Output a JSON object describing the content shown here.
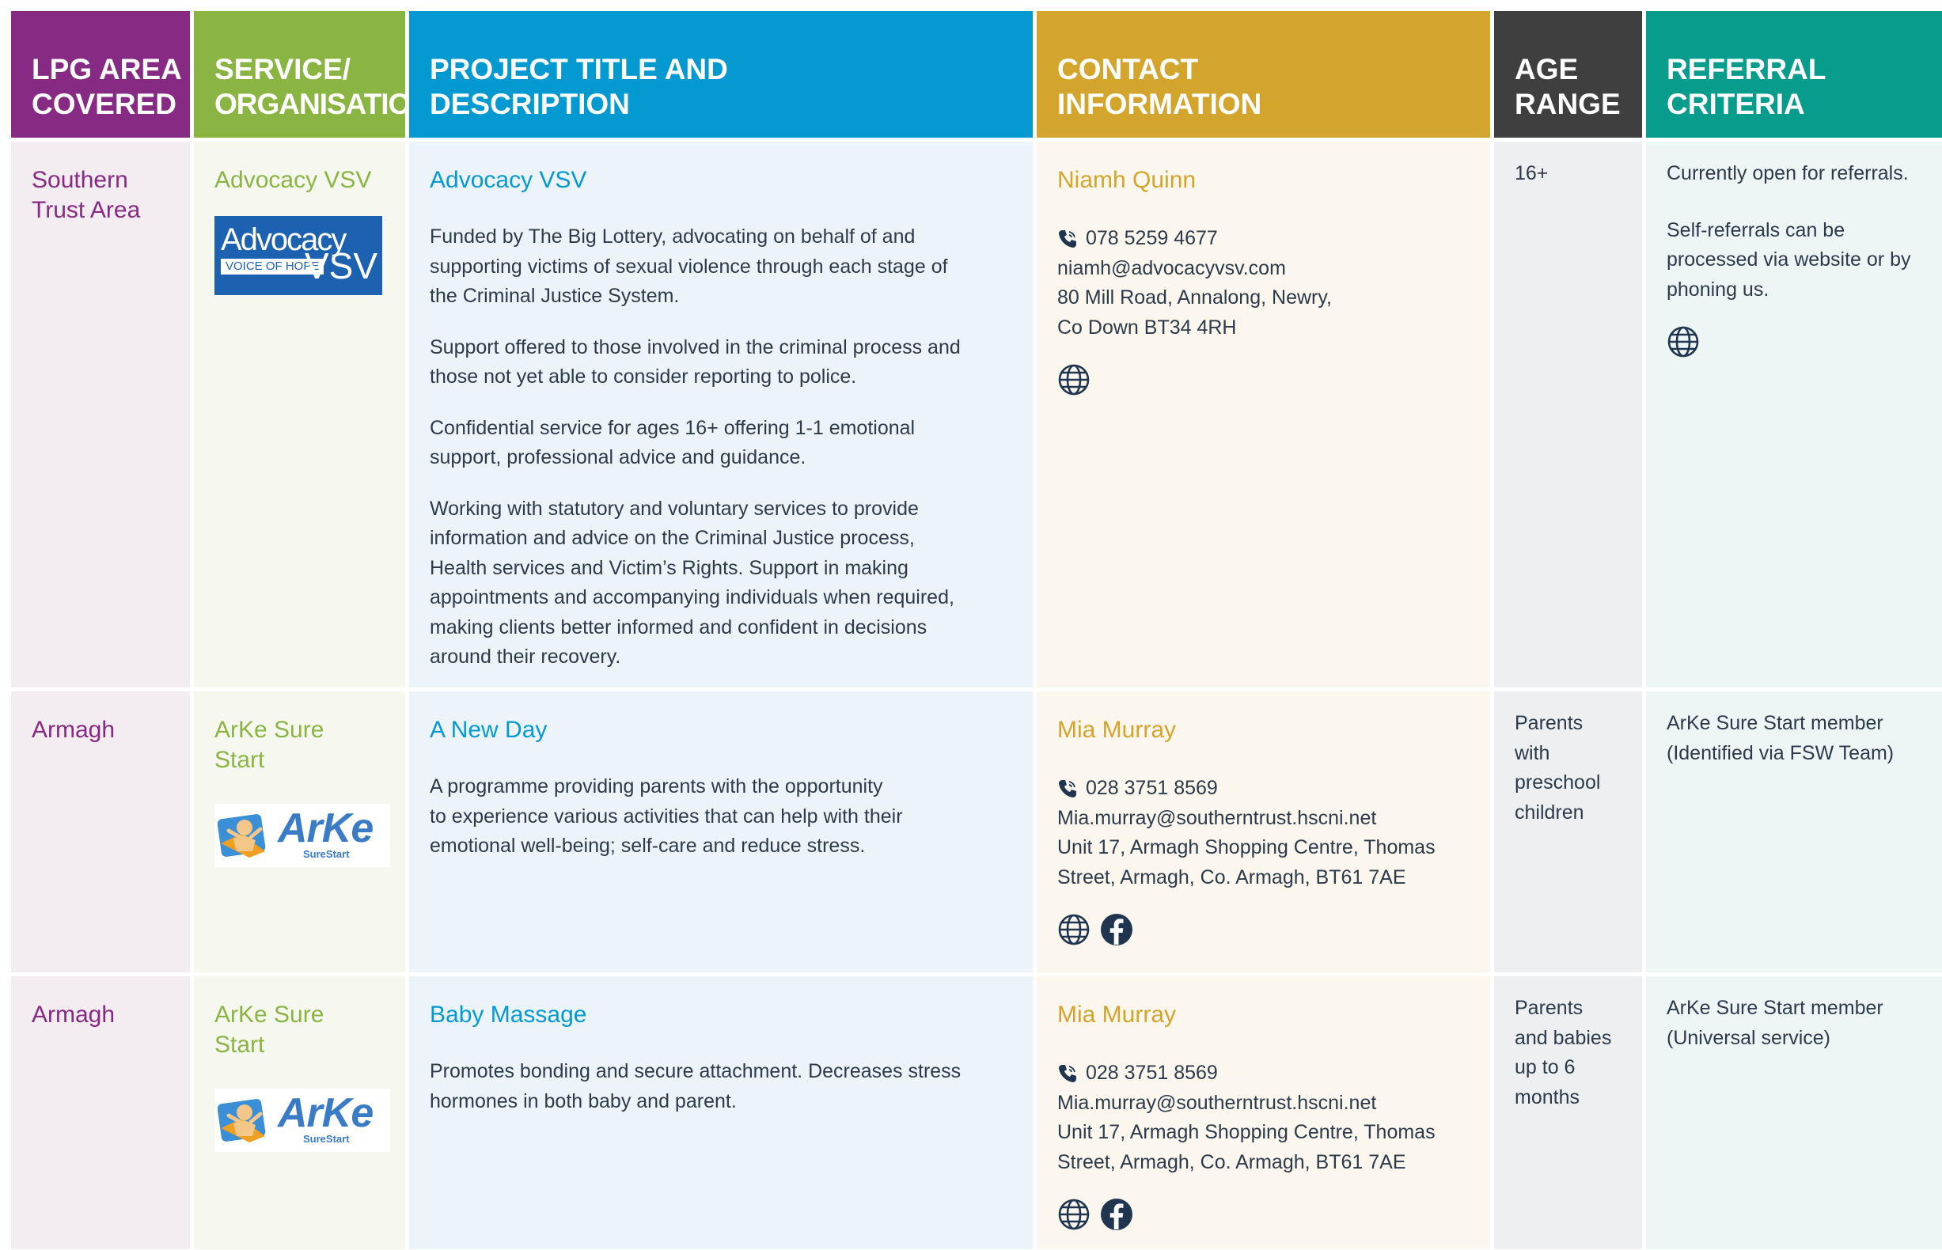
{
  "headers": {
    "lpg": [
      "LPG AREA",
      "COVERED"
    ],
    "service": [
      "SERVICE/",
      "ORGANISATION"
    ],
    "project": [
      "PROJECT TITLE AND",
      "DESCRIPTION"
    ],
    "contact": [
      "CONTACT",
      "INFORMATION"
    ],
    "age": [
      "AGE",
      "RANGE"
    ],
    "referral": [
      "REFERRAL",
      "CRITERIA"
    ]
  },
  "colors": {
    "lpg": "#862a83",
    "service": "#8ab542",
    "project": "#0599d1",
    "contact": "#d3a52c",
    "age": "#3f3f40",
    "referral": "#079c8c"
  },
  "rows": [
    {
      "area": [
        "Southern",
        "Trust Area"
      ],
      "organisation": [
        "Advocacy VSV"
      ],
      "logo": {
        "type": "advocacy-vsv-logo",
        "text_main": "Advocacy",
        "text_sub": "VOICE OF HOPE",
        "text_right": "VSV"
      },
      "project_title": "Advocacy VSV",
      "description": [
        [
          "Funded by The Big Lottery, advocating on behalf of and",
          "supporting victims of sexual violence through each stage of",
          "the Criminal Justice System."
        ],
        [
          "Support offered to those involved in the criminal process and",
          "those not yet able to consider reporting to police."
        ],
        [
          "Confidential service for ages 16+ offering 1-1 emotional",
          "support, professional advice and guidance."
        ],
        [
          "Working with statutory and voluntary services to provide",
          "information and advice on the Criminal Justice process,",
          "Health services and Victim’s Rights. Support in making",
          "appointments and accompanying individuals when required,",
          "making clients better informed and confident in decisions",
          "around  their recovery."
        ]
      ],
      "contact_name": "Niamh Quinn",
      "phone": "078 5259 4677",
      "address_lines": [
        "niamh@advocacyvsv.com",
        "80 Mill Road, Annalong, Newry,",
        "Co Down BT34 4RH"
      ],
      "contact_icons": [
        "globe-icon"
      ],
      "age": [
        "16+"
      ],
      "referral": [
        [
          "Currently open for referrals."
        ],
        [
          "Self-referrals can be",
          "processed via website or by",
          "phoning us."
        ]
      ],
      "referral_icons": [
        "globe-icon"
      ]
    },
    {
      "area": [
        "Armagh"
      ],
      "organisation": [
        "ArKe Sure",
        "Start"
      ],
      "logo": {
        "type": "arke-surestart-logo",
        "text_main": "ArKe",
        "text_sub": "SureStart"
      },
      "project_title": "A New Day",
      "description": [
        [
          "A programme providing parents with the opportunity",
          "to experience various activities that can help with their",
          "emotional well-being; self-care and reduce stress."
        ]
      ],
      "contact_name": "Mia Murray",
      "phone": "028 3751 8569",
      "address_lines": [
        "Mia.murray@southerntrust.hscni.net",
        "Unit 17, Armagh Shopping Centre, Thomas",
        "Street, Armagh, Co. Armagh, BT61 7AE"
      ],
      "contact_icons": [
        "globe-icon",
        "facebook-icon"
      ],
      "age": [
        "Parents",
        "with",
        "preschool",
        "children"
      ],
      "referral": [
        [
          "ArKe Sure Start member",
          "(Identified via FSW Team)"
        ]
      ],
      "referral_icons": []
    },
    {
      "area": [
        "Armagh"
      ],
      "organisation": [
        "ArKe Sure",
        "Start"
      ],
      "logo": {
        "type": "arke-surestart-logo",
        "text_main": "ArKe",
        "text_sub": "SureStart"
      },
      "project_title": "Baby Massage",
      "description": [
        [
          "Promotes bonding and secure attachment. Decreases stress",
          "hormones in both baby and parent."
        ]
      ],
      "contact_name": "Mia Murray",
      "phone": "028 3751 8569",
      "address_lines": [
        "Mia.murray@southerntrust.hscni.net",
        "Unit 17, Armagh Shopping Centre, Thomas",
        "Street, Armagh, Co. Armagh, BT61 7AE"
      ],
      "contact_icons": [
        "globe-icon",
        "facebook-icon"
      ],
      "age": [
        "Parents",
        "and babies",
        "up to 6",
        "months"
      ],
      "referral": [
        [
          "ArKe Sure Start member",
          "(Universal service)"
        ]
      ],
      "referral_icons": []
    }
  ]
}
